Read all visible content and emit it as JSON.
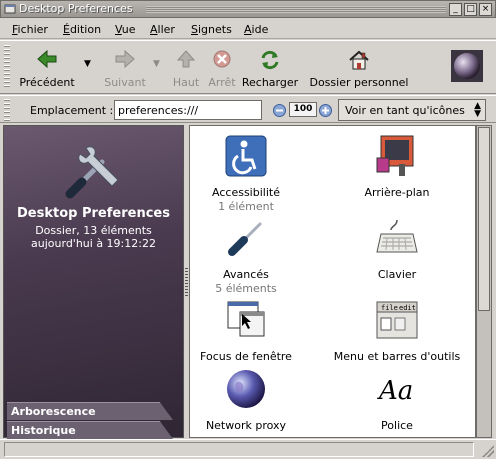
{
  "window": {
    "title": "Desktop Preferences",
    "controls": [
      "_",
      "□",
      "×"
    ]
  },
  "menubar": {
    "items": [
      "Fichier",
      "Édition",
      "Vue",
      "Aller",
      "Signets",
      "Aide"
    ]
  },
  "toolbar": {
    "back_label": "Précédent",
    "forward_label": "Suivant",
    "up_label": "Haut",
    "stop_label": "Arrêt",
    "reload_label": "Recharger",
    "home_label": "Dossier personnel"
  },
  "location": {
    "label": "Emplacement :",
    "value": "preferences:///",
    "zoom_value": "100",
    "view_as": "Voir en tant qu'icônes"
  },
  "sidepane": {
    "title": "Desktop Preferences",
    "info_line1": "Dossier, 13 éléments",
    "info_line2": "aujourd'hui à 19:12:22",
    "tab_tree": "Arborescence",
    "tab_history": "Historique"
  },
  "icons": [
    {
      "name": "Accessibilité",
      "count": "1 élément"
    },
    {
      "name": "Arrière-plan",
      "count": ""
    },
    {
      "name": "Avancés",
      "count": "5 éléments"
    },
    {
      "name": "Clavier",
      "count": ""
    },
    {
      "name": "Focus de fenêtre",
      "count": ""
    },
    {
      "name": "Menu et barres d'outils",
      "count": ""
    },
    {
      "name": "Network proxy",
      "count": ""
    },
    {
      "name": "Police",
      "count": ""
    }
  ],
  "icon_text": {
    "font_glyph": "Aa",
    "menu_file": "file",
    "menu_edit": "edit"
  },
  "colors": {
    "sidepane_top": "#6b5a6f",
    "sidepane_bottom": "#2f2634",
    "back_arrow": "#3a8a2a",
    "stop_red": "#c84a3a"
  }
}
